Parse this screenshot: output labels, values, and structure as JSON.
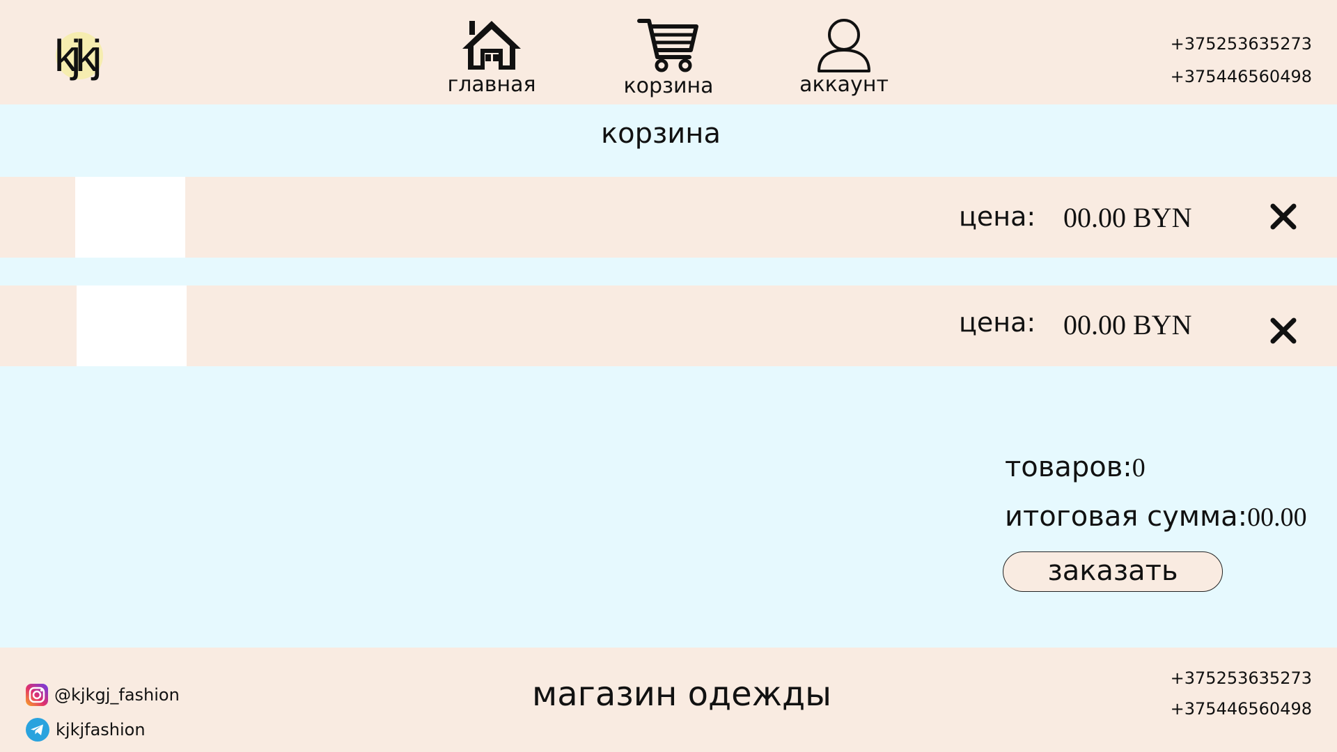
{
  "header": {
    "logo_text": "kjkj",
    "nav": [
      {
        "label": "главная",
        "icon": "home-icon"
      },
      {
        "label": "корзина",
        "icon": "cart-icon"
      },
      {
        "label": "аккаунт",
        "icon": "user-icon"
      }
    ],
    "phones": [
      "+375253635273",
      "+375446560498"
    ]
  },
  "page": {
    "title": "корзина"
  },
  "cart": {
    "items": [
      {
        "price_label": "цена:",
        "price": "00.00 BYN",
        "remove_icon": "close-icon"
      },
      {
        "price_label": "цена:",
        "price": "00.00 BYN",
        "remove_icon": "close-icon"
      }
    ]
  },
  "summary": {
    "items_label": "товаров:",
    "items_count": "0",
    "total_label": "итоговая сумма:",
    "total_value": "00.00",
    "order_button": "заказать"
  },
  "footer": {
    "instagram": "@kjkgj_fashion",
    "telegram": "kjkjfashion",
    "title": "магазин одежды",
    "phones": [
      "+375253635273",
      "+375446560498"
    ]
  },
  "colors": {
    "peach": "#F9EBE1",
    "light_blue": "#E6F9FE",
    "logo_circle": "#F6EDB0",
    "thumb": "#FFFFFF"
  }
}
